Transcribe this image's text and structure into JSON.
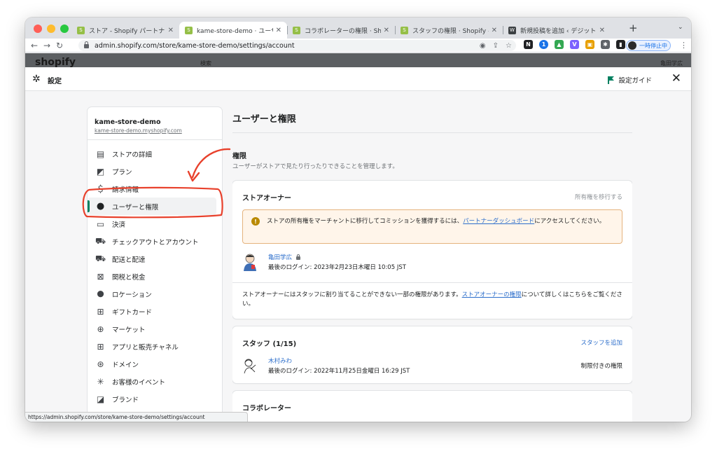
{
  "browser": {
    "tabs": [
      {
        "title": "ストア - Shopify パートナー",
        "favicon_color": "#95bf47"
      },
      {
        "title": "kame-store-demo · ユーザーと権",
        "favicon_color": "#95bf47"
      },
      {
        "title": "コラボレーターの権限 · Shopify ヘ",
        "favicon_color": "#95bf47"
      },
      {
        "title": "スタッフの権限 · Shopify ヘルプセ",
        "favicon_color": "#95bf47"
      },
      {
        "title": "新規投稿を追加 ‹ デジット — Wo",
        "favicon_color": "#3c4043"
      }
    ],
    "url": "admin.shopify.com/store/kame-store-demo/settings/account",
    "pause_label": "一時停止中",
    "status_url": "https://admin.shopify.com/store/kame-store-demo/settings/account"
  },
  "shop_bar": {
    "logo": "shopify",
    "search": "検索",
    "account": "亀田学広"
  },
  "settings": {
    "title": "設定",
    "guide_label": "設定ガイド"
  },
  "sidebar": {
    "store_name": "kame-store-demo",
    "store_url": "kame-store-demo.myshopify.com",
    "items": [
      {
        "label": "ストアの詳細",
        "icon": "store-icon"
      },
      {
        "label": "プラン",
        "icon": "plan-icon"
      },
      {
        "label": "請求情報",
        "icon": "billing-icon"
      },
      {
        "label": "ユーザーと権限",
        "icon": "user-icon"
      },
      {
        "label": "決済",
        "icon": "payment-icon"
      },
      {
        "label": "チェックアウトとアカウント",
        "icon": "cart-icon"
      },
      {
        "label": "配送と配達",
        "icon": "truck-icon"
      },
      {
        "label": "関税と税金",
        "icon": "tax-icon"
      },
      {
        "label": "ロケーション",
        "icon": "location-icon"
      },
      {
        "label": "ギフトカード",
        "icon": "gift-icon"
      },
      {
        "label": "マーケット",
        "icon": "globe-icon"
      },
      {
        "label": "アプリと販売チャネル",
        "icon": "apps-icon"
      },
      {
        "label": "ドメイン",
        "icon": "domain-icon"
      },
      {
        "label": "お客様のイベント",
        "icon": "sparkle-icon"
      },
      {
        "label": "ブランド",
        "icon": "brand-icon"
      }
    ],
    "active_index": 3
  },
  "main": {
    "page_title": "ユーザーと権限",
    "section_title": "権限",
    "section_desc": "ユーザーがストアで見たり行ったりできることを管理します。",
    "owner_card": {
      "title": "ストアオーナー",
      "action": "所有権を移行する",
      "banner_text_1": "ストアの所有権をマーチャントに移行してコミッションを獲得するには、",
      "banner_link": "パートナーダッシュボード",
      "banner_text_2": "にアクセスしてください。",
      "owner_name": "亀田学広",
      "owner_last_login": "最後のログイン: 2023年2月23日木曜日 10:05 JST",
      "note_1": "ストアオーナーにはスタッフに割り当てることができない一部の権限があります。",
      "note_link": "ストアオーナーの権限",
      "note_2": "について詳しくはこちらをご覧ください。"
    },
    "staff_card": {
      "title": "スタッフ (1/15)",
      "action": "スタッフを追加",
      "member_name": "木村みわ",
      "member_last_login": "最後のログイン: 2022年11月25日金曜日 16:29 JST",
      "member_permission": "制限付きの権限"
    },
    "collab_card": {
      "title": "コラボレーター"
    }
  },
  "colors": {
    "accent_green": "#008060",
    "link_blue": "#2c6ecb",
    "annotation_red": "#e8412c",
    "warning_bg": "#fff5ea"
  }
}
